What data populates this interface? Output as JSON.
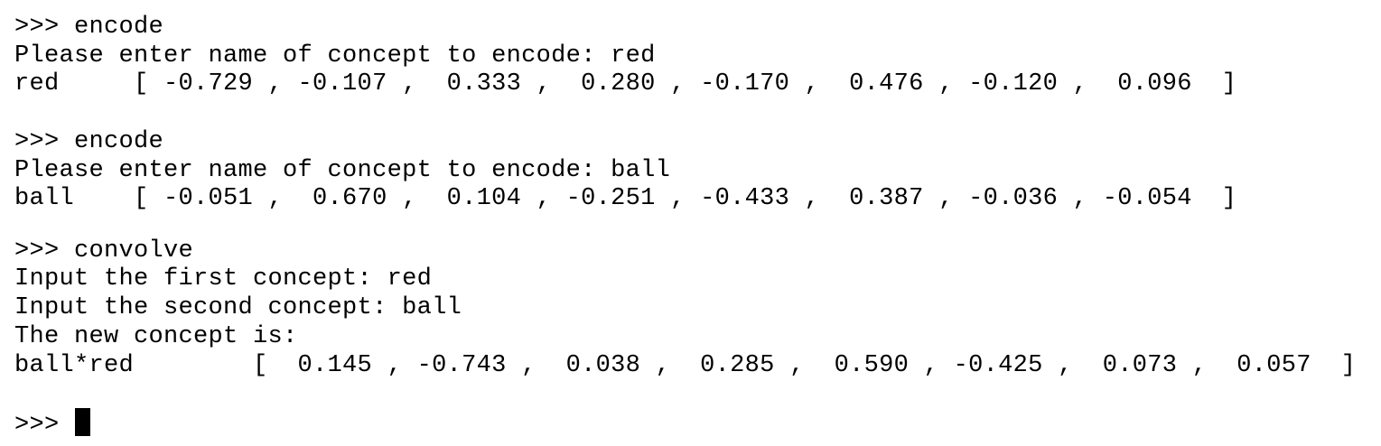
{
  "terminal": {
    "prompt": ">>> ",
    "lines": {
      "l0": ">>> encode",
      "l1": "Please enter name of concept to encode: red",
      "l2": "red     [ -0.729 , -0.107 ,  0.333 ,  0.280 , -0.170 ,  0.476 , -0.120 ,  0.096  ]",
      "l3": ">>> encode",
      "l4": "Please enter name of concept to encode: ball",
      "l5": "ball    [ -0.051 ,  0.670 ,  0.104 , -0.251 , -0.433 ,  0.387 , -0.036 , -0.054  ]",
      "l6": ">>> convolve",
      "l7": "Input the first concept: red",
      "l8": "Input the second concept: ball",
      "l9": "The new concept is:",
      "l10": "ball*red        [  0.145 , -0.743 ,  0.038 ,  0.285 ,  0.590 , -0.425 ,  0.073 ,  0.057  ]"
    }
  }
}
